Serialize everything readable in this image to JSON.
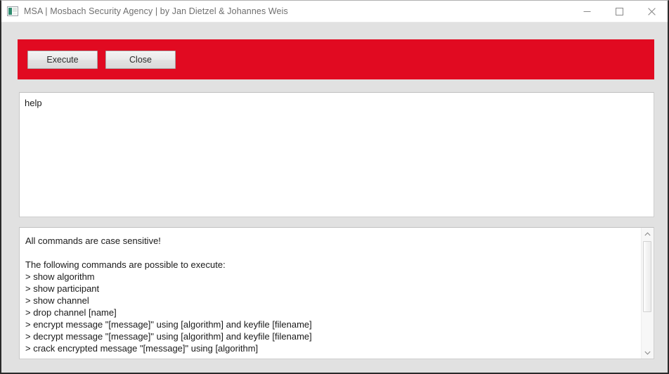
{
  "window": {
    "title": "MSA | Mosbach Security Agency | by Jan Dietzel & Johannes Weis",
    "icon": "application-icon",
    "controls": {
      "minimize_label": "Minimize",
      "maximize_label": "Maximize",
      "close_label": "Close"
    }
  },
  "toolbar": {
    "background_color": "#e10a21",
    "execute_label": "Execute",
    "close_label": "Close"
  },
  "input": {
    "value": "help",
    "placeholder": ""
  },
  "output": {
    "text": "All commands are case sensitive!\n\nThe following commands are possible to execute:\n> show algorithm\n> show participant\n> show channel\n> drop channel [name]\n> encrypt message \"[message]\" using [algorithm] and keyfile [filename]\n> decrypt message \"[message]\" using [algorithm] and keyfile [filename]\n> crack encrypted message \"[message]\" using [algorithm]",
    "lines": [
      "All commands are case sensitive!",
      "",
      "The following commands are possible to execute:",
      "> show algorithm",
      "> show participant",
      "> show channel",
      "> drop channel [name]",
      "> encrypt message \"[message]\" using [algorithm] and keyfile [filename]",
      "> decrypt message \"[message]\" using [algorithm] and keyfile [filename]",
      "> crack encrypted message \"[message]\" using [algorithm]"
    ],
    "scrollbar": {
      "up_arrow": "chevron-up-icon",
      "down_arrow": "chevron-down-icon"
    }
  },
  "colors": {
    "window_background": "#e1e1e1",
    "accent_red": "#e10a21",
    "title_text": "#6f6f6f",
    "body_text": "#1a1a1a"
  }
}
